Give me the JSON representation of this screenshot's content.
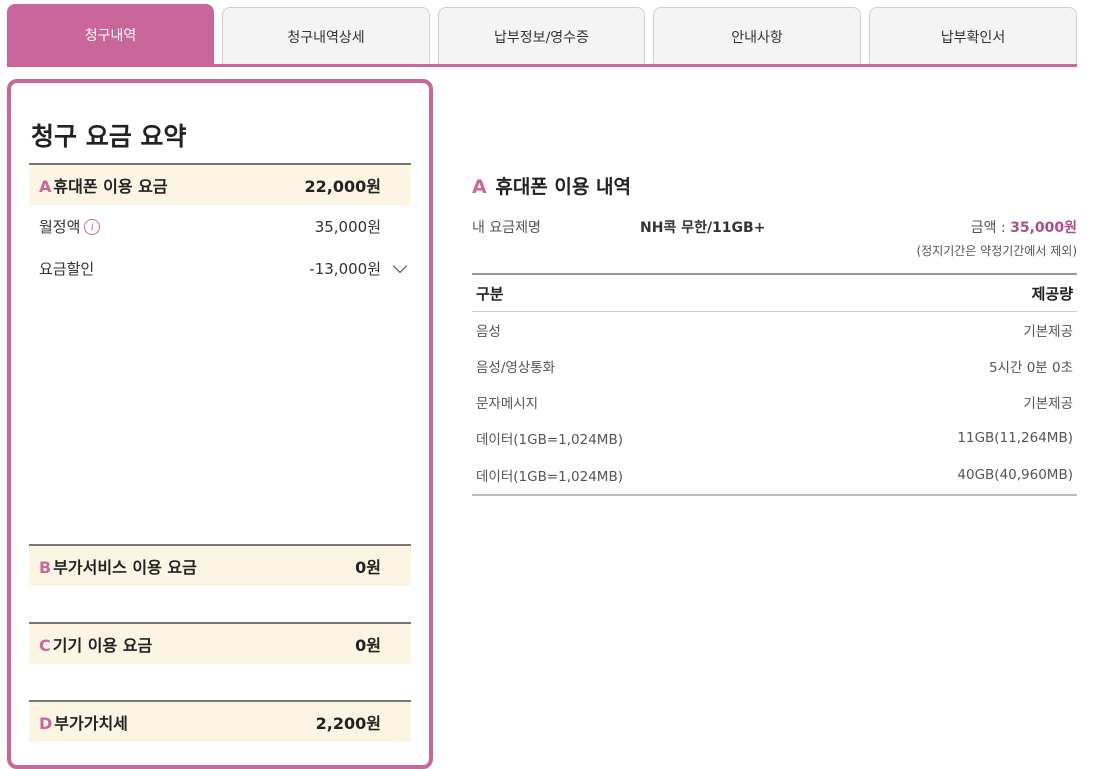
{
  "tabs": [
    {
      "label": "청구내역",
      "active": true
    },
    {
      "label": "청구내역상세",
      "active": false
    },
    {
      "label": "납부정보/영수증",
      "active": false
    },
    {
      "label": "안내사항",
      "active": false
    },
    {
      "label": "납부확인서",
      "active": false
    }
  ],
  "summary": {
    "title": "청구 요금 요약",
    "sections": [
      {
        "letter": "A",
        "label": "휴대폰 이용 요금",
        "amount": "22,000원",
        "rows": [
          {
            "label": "월정액",
            "amount": "35,000원"
          },
          {
            "label": "요금할인",
            "amount": "-13,000원"
          }
        ]
      },
      {
        "letter": "B",
        "label": "부가서비스 이용 요금",
        "amount": "0원"
      },
      {
        "letter": "C",
        "label": "기기 이용 요금",
        "amount": "0원"
      },
      {
        "letter": "D",
        "label": "부가가치세",
        "amount": "2,200원"
      }
    ]
  },
  "detail": {
    "letter": "A",
    "title": "휴대폰 이용 내역",
    "plan_label": "내 요금제명",
    "plan_name": "NH콕 무한/11GB+",
    "amount_label": "금액 : ",
    "amount_value": "35,000원",
    "note": "(정지기간은 약정기간에서 제외)",
    "table": {
      "headers": [
        "구분",
        "제공량"
      ],
      "rows": [
        [
          "음성",
          "기본제공"
        ],
        [
          "음성/영상통화",
          "5시간 0분 0초"
        ],
        [
          "문자메시지",
          "기본제공"
        ],
        [
          "데이터(1GB=1,024MB)",
          "11GB(11,264MB)"
        ],
        [
          "데이터(1GB=1,024MB)",
          "40GB(40,960MB)"
        ]
      ]
    }
  },
  "colors": {
    "accent": "#c9669a",
    "highlight_bg": "#fdf5e4"
  }
}
